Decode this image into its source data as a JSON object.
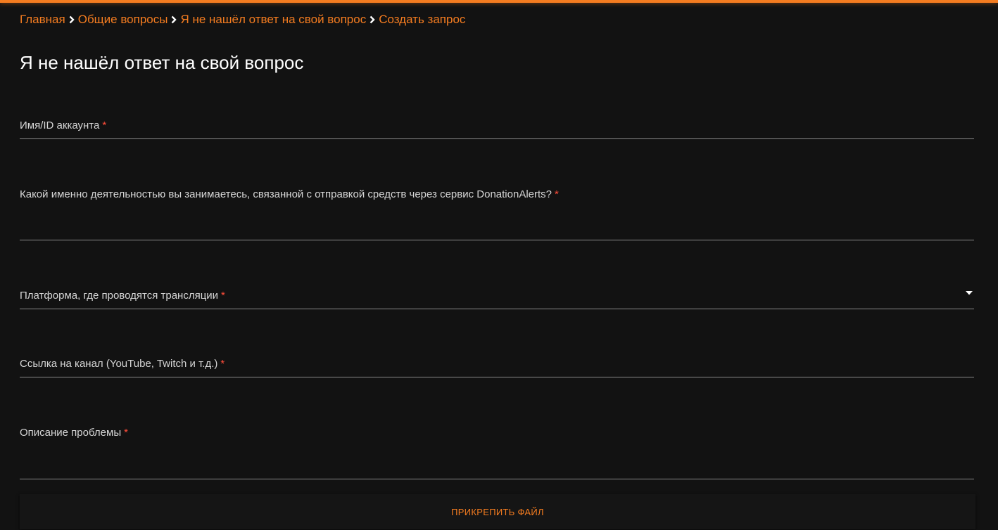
{
  "colors": {
    "accent": "#f47c20",
    "background": "#121212",
    "required": "#ff4d3a"
  },
  "breadcrumb": {
    "items": [
      {
        "label": "Главная"
      },
      {
        "label": "Общие вопросы"
      },
      {
        "label": "Я не нашёл ответ на свой вопрос"
      },
      {
        "label": "Создать запрос"
      }
    ],
    "separator_icon": "chevron-right-icon"
  },
  "page": {
    "title": "Я не нашёл ответ на свой вопрос"
  },
  "form": {
    "required_mark": "*",
    "fields": [
      {
        "label": "Имя/ID аккаунта",
        "value": ""
      },
      {
        "label": "Какой именно деятельностью вы занимаетесь, связанной с отправкой средств через сервис DonationAlerts?",
        "value": ""
      },
      {
        "label": "Платформа, где проводятся трансляции",
        "value": "",
        "icon": "caret-down-icon"
      },
      {
        "label": "Ссылка на канал (YouTube, Twitch и т.д.)",
        "value": ""
      },
      {
        "label": "Описание проблемы",
        "value": ""
      }
    ],
    "attach_button_label": "ПРИКРЕПИТЬ ФАЙЛ"
  }
}
